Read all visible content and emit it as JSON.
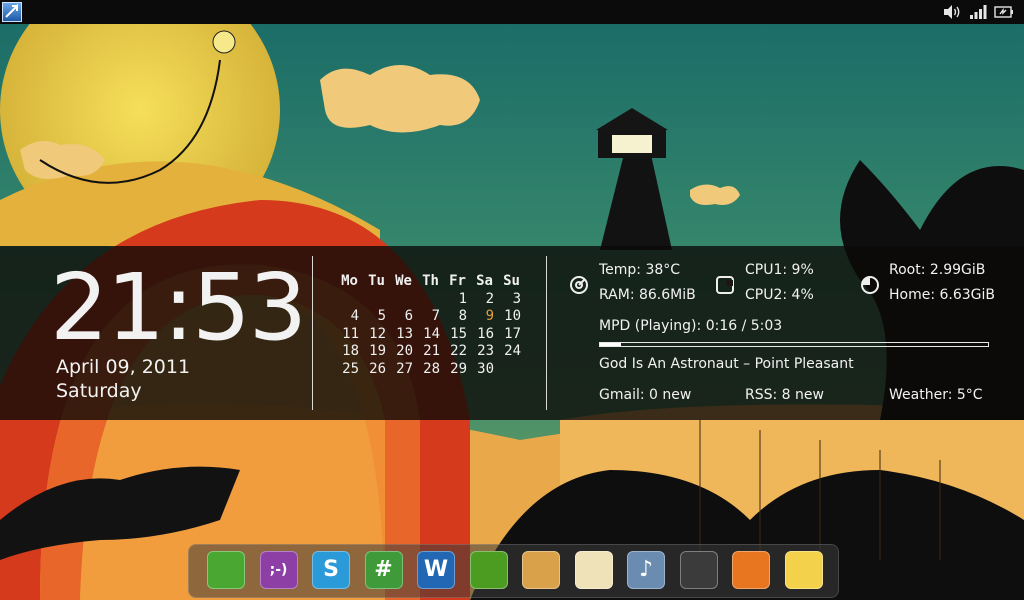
{
  "panel": {
    "tray_icons": [
      "volume-icon",
      "signal-icon",
      "battery-icon"
    ]
  },
  "clock": {
    "time": "21:53",
    "date": "April 09, 2011",
    "day": "Saturday"
  },
  "calendar": {
    "headers": [
      "Mo",
      "Tu",
      "We",
      "Th",
      "Fr",
      "Sa",
      "Su"
    ],
    "weeks": [
      [
        "",
        "",
        "",
        "",
        "1",
        "2",
        "3"
      ],
      [
        "4",
        "5",
        "6",
        "7",
        "8",
        "9",
        "10"
      ],
      [
        "11",
        "12",
        "13",
        "14",
        "15",
        "16",
        "17"
      ],
      [
        "18",
        "19",
        "20",
        "21",
        "22",
        "23",
        "24"
      ],
      [
        "25",
        "26",
        "27",
        "28",
        "29",
        "30",
        ""
      ]
    ],
    "today": "9",
    "today_color": "#e2a23a"
  },
  "system": {
    "temp": "Temp: 38°C",
    "ram": "RAM: 86.6MiB",
    "cpu1": "CPU1: 9%",
    "cpu2": "CPU2: 4%",
    "root": "Root: 2.99GiB",
    "home": "Home: 6.63GiB"
  },
  "mpd": {
    "status": "MPD (Playing): 0:16 / 5:03",
    "progress": 0.053,
    "track": "God Is An Astronaut – Point Pleasant"
  },
  "feeds": {
    "gmail": "Gmail: 0 new",
    "rss": "RSS: 8 new",
    "weather": "Weather: 5°C"
  },
  "dock": {
    "icons": [
      {
        "name": "gwibber-icon",
        "glyph": "",
        "bg": "#4aa832"
      },
      {
        "name": "pidgin-icon",
        "glyph": ";-)",
        "bg": "#8d3fa6"
      },
      {
        "name": "skype-icon",
        "glyph": "S",
        "bg": "#2a9ad8"
      },
      {
        "name": "hashtag-icon",
        "glyph": "#",
        "bg": "#3f9a3a"
      },
      {
        "name": "writer-icon",
        "glyph": "W",
        "bg": "#2167b3"
      },
      {
        "name": "phone-icon",
        "glyph": "",
        "bg": "#4c9c22"
      },
      {
        "name": "paint-icon",
        "glyph": "",
        "bg": "#d9a24a"
      },
      {
        "name": "mail-icon",
        "glyph": "",
        "bg": "#efe1b8"
      },
      {
        "name": "itunes-icon",
        "glyph": "♪",
        "bg": "#6a8cb0"
      },
      {
        "name": "vlc-icon",
        "glyph": "",
        "bg": "#3b3b3b"
      },
      {
        "name": "rss-icon",
        "glyph": "",
        "bg": "#e8751f"
      },
      {
        "name": "dropbox-icon",
        "glyph": "",
        "bg": "#f3d14a"
      }
    ]
  }
}
